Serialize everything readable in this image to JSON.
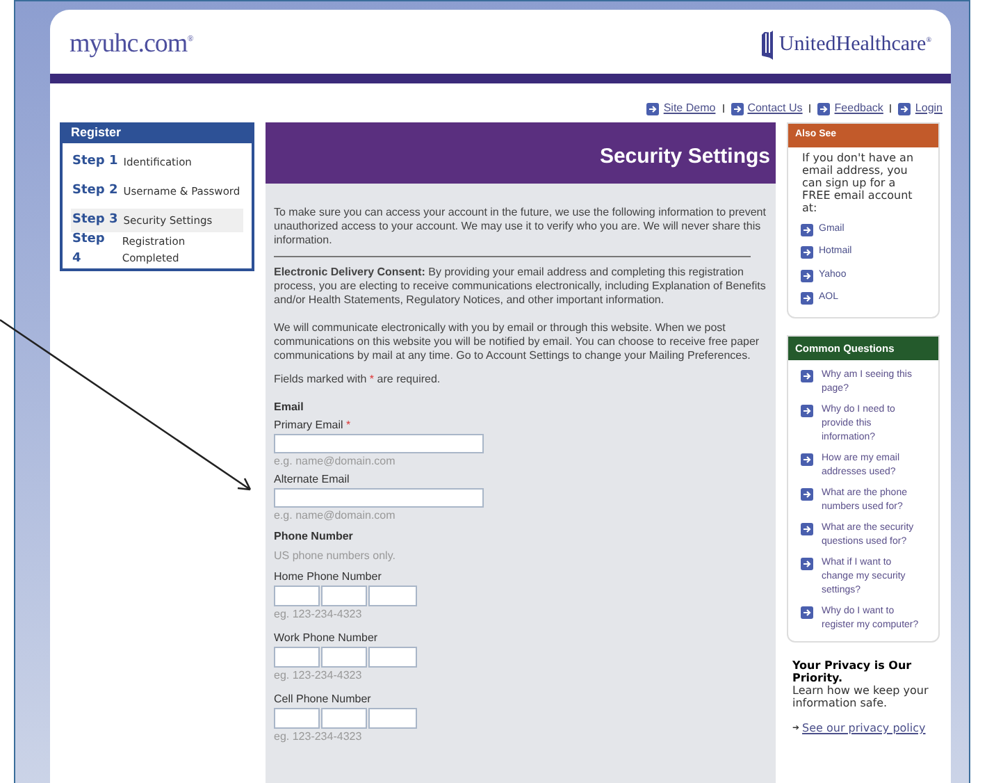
{
  "header": {
    "site_logo": "myuhc.com",
    "site_logo_mark": "®",
    "brand_logo": "UnitedHealthcare",
    "brand_logo_mark": "®"
  },
  "top_links": [
    "Site Demo",
    "Contact Us",
    "Feedback",
    "Login"
  ],
  "register": {
    "title": "Register",
    "steps": [
      {
        "number": "Step 1",
        "label": "Identification",
        "selected": false
      },
      {
        "number": "Step 2",
        "label": "Username & Password",
        "selected": false
      },
      {
        "number": "Step 3",
        "label": "Security Settings",
        "selected": true
      },
      {
        "number": "Step 4",
        "label": "Registration Completed",
        "selected": false
      }
    ]
  },
  "main": {
    "title": "Security Settings",
    "intro": "To make sure you can access your account in the future, we use the following information to prevent unauthorized access to your account. We may use it to verify who you are. We will never share this information.",
    "consent": "**Electronic Delivery Consent:** By providing your email address and completing this registration process, you are electing to receive communications electronically, including Explanation of Benefits and/or Health Statements, Regulatory Notices, and other important information.",
    "communication": "We will communicate electronically with you by email or through this website. When we post communications on this website you will be notified by email. You can choose to receive free paper communications by mail at any time. Go to Account Settings to change your Mailing Preferences.",
    "required_note": {
      "before": "Fields marked with",
      "mark": "*",
      "after": "are required."
    },
    "email": {
      "heading": "Email",
      "fields": [
        {
          "label": "Primary Email",
          "required_mark": "*",
          "hint": "e.g. name@domain.com"
        },
        {
          "label": "Alternate Email",
          "hint": "e.g. name@domain.com"
        }
      ]
    },
    "phone": {
      "heading": "Phone Number",
      "note": "US phone numbers only.",
      "fields": [
        {
          "label": "Home Phone Number",
          "hint": "eg. 123-234-4323"
        },
        {
          "label": "Work Phone Number",
          "hint": "eg. 123-234-4323"
        },
        {
          "label": "Cell Phone Number",
          "hint": "eg. 123-234-4323"
        }
      ]
    }
  },
  "also_see": {
    "title": "Also See",
    "text": "If you don't have an email address, you can sign up for a FREE email account at:",
    "links": [
      "Gmail",
      "Hotmail",
      "Yahoo",
      "AOL"
    ]
  },
  "common_questions": {
    "title": "Common Questions",
    "links": [
      "Why am I seeing this page?",
      "Why do I need to provide this information?",
      "How are my email addresses used?",
      "What are the phone numbers used for?",
      "What are the security questions used for?",
      "What if I want to change my security settings?",
      "Why do I want to register my computer?"
    ]
  },
  "privacy": {
    "title": "Your Privacy is Our Priority.",
    "text": "Learn how we keep your information safe.",
    "link_arrow": "➔",
    "link": "See our privacy policy"
  }
}
